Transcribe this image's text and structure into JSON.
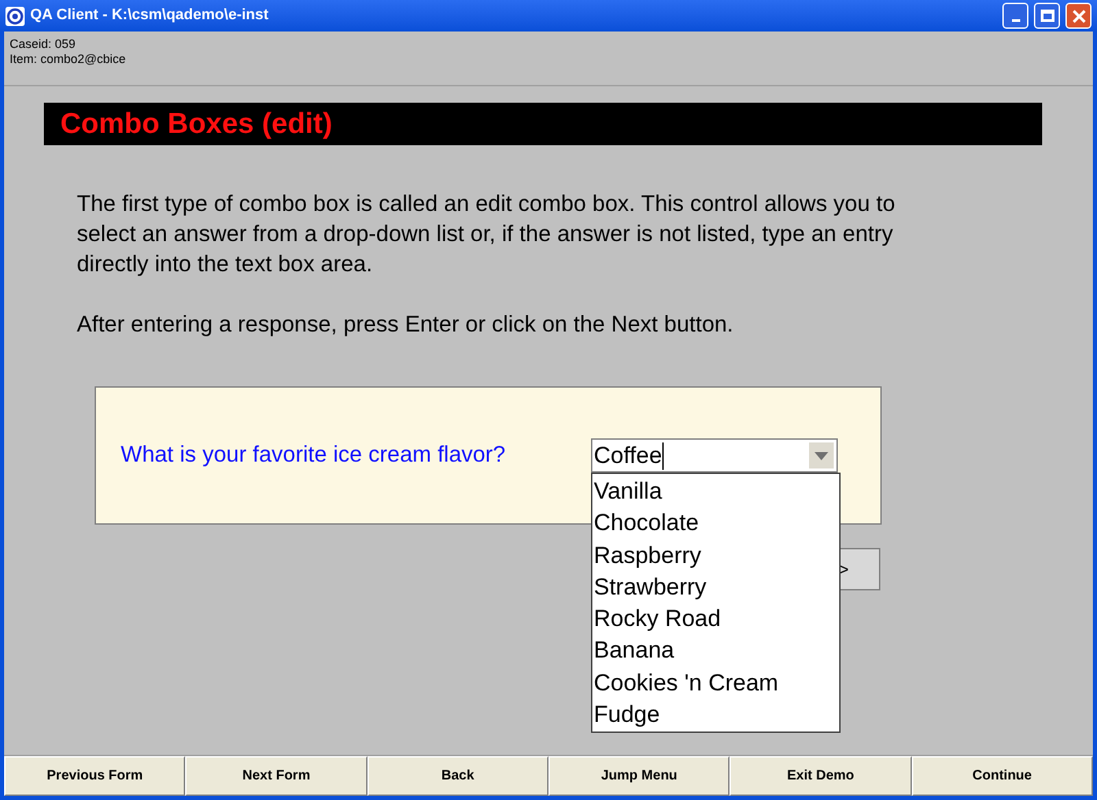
{
  "window": {
    "title": "QA Client - K:\\csm\\qademo\\e-inst"
  },
  "info": [
    "Caseid: 059",
    "Item: combo2@cbice"
  ],
  "banner": "Combo Boxes (edit)",
  "paragraphs": [
    "The first type of combo box is called an edit combo box.  This control allows you to select an answer from a drop-down list or, if the answer is not listed, type an entry directly into the text box area.",
    "After entering a response, press Enter or click on the Next button."
  ],
  "question": {
    "label": "What is your favorite ice cream flavor?",
    "value": "Coffee",
    "expanded": true,
    "options": [
      {
        "label": "Vanilla"
      },
      {
        "label": "Chocolate"
      },
      {
        "label": "Raspberry"
      },
      {
        "label": "Strawberry"
      },
      {
        "label": "Rocky Road"
      },
      {
        "label": "Banana"
      },
      {
        "label": "Cookies 'n Cream"
      },
      {
        "label": "Fudge"
      }
    ]
  },
  "next_button": ">",
  "nav_buttons": [
    "Previous Form",
    "Next Form",
    "Back",
    "Jump Menu",
    "Exit Demo",
    "Continue"
  ]
}
